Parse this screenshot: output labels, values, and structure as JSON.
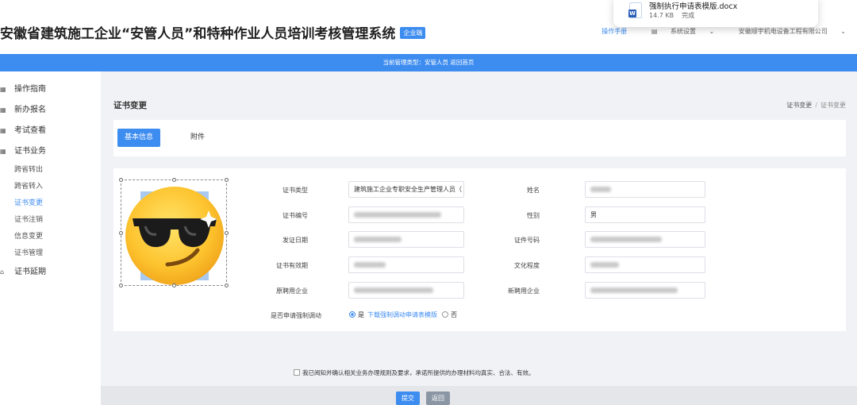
{
  "header": {
    "system_title": "安徽省建筑施工企业“安管人员”和特种作业人员培训考核管理系统",
    "badge": "企业端",
    "help_link": "操作手册",
    "settings_label": "系统设置",
    "company_name": "安徽顺宇机电设备工程有限公司"
  },
  "download": {
    "file_name": "强制执行申请表模版.docx",
    "file_size": "14.7 KB",
    "status": "完成",
    "icon": "word-doc-icon"
  },
  "banner": {
    "text": "当前管理类型：安管人员  返回首页"
  },
  "sidebar": {
    "items": [
      {
        "label": "操作指南",
        "icon": "grid-icon"
      },
      {
        "label": "新办报名",
        "icon": "grid-icon"
      },
      {
        "label": "考试查看",
        "icon": "grid-icon"
      },
      {
        "label": "证书业务",
        "icon": "grid-icon"
      },
      {
        "label": "证书延期",
        "icon": "home-icon"
      }
    ],
    "sub_items": [
      {
        "label": "跨省转出"
      },
      {
        "label": "跨省转入"
      },
      {
        "label": "证书变更"
      },
      {
        "label": "证书注销"
      },
      {
        "label": "信息变更"
      },
      {
        "label": "证书管理"
      }
    ]
  },
  "page": {
    "title": "证书变更",
    "breadcrumb": [
      "证书变更",
      "证书变更"
    ],
    "tabs": [
      {
        "label": "基本信息"
      },
      {
        "label": "附件"
      }
    ]
  },
  "form": {
    "cert_type_label": "证书类型",
    "cert_type_value": "建筑施工企业专职安全生产管理人员（",
    "cert_no_label": "证书编号",
    "issue_date_label": "发证日期",
    "valid_until_label": "证书有效期",
    "old_employer_label": "原聘用企业",
    "name_label": "姓名",
    "gender_label": "性别",
    "gender_value": "男",
    "id_no_label": "证件号码",
    "education_label": "文化程度",
    "new_employer_label": "新聘用企业",
    "forced_transfer_label": "是否申请强制调动",
    "yes_label": "是",
    "download_link": "下载强制调动申请表模版",
    "no_label": "否"
  },
  "footer": {
    "agreement": "我已阅知并确认相关业务办理规则及要求，承诺所提供的办理材料均真实、合法、有效。",
    "submit_label": "提交",
    "back_label": "返回"
  },
  "colors": {
    "primary": "#3d8cf0"
  }
}
